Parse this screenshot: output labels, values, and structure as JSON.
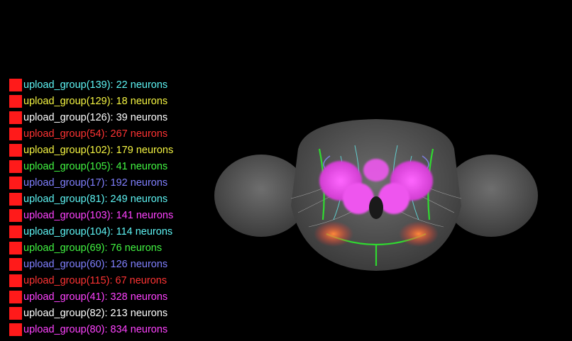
{
  "legend": {
    "swatch_color": "#ff1a1a",
    "items": [
      {
        "label": "upload_group(139): 22 neurons",
        "color": "#5ef5f5"
      },
      {
        "label": "upload_group(129): 18 neurons",
        "color": "#f5f542"
      },
      {
        "label": "upload_group(126): 39 neurons",
        "color": "#ffffff"
      },
      {
        "label": "upload_group(54): 267 neurons",
        "color": "#ff3333"
      },
      {
        "label": "upload_group(102): 179 neurons",
        "color": "#f5f542"
      },
      {
        "label": "upload_group(105): 41 neurons",
        "color": "#42f542"
      },
      {
        "label": "upload_group(17): 192 neurons",
        "color": "#8080ff"
      },
      {
        "label": "upload_group(81): 249 neurons",
        "color": "#5ef5f5"
      },
      {
        "label": "upload_group(103): 141 neurons",
        "color": "#ff42ff"
      },
      {
        "label": "upload_group(104): 114 neurons",
        "color": "#5ef5f5"
      },
      {
        "label": "upload_group(69): 76 neurons",
        "color": "#42f542"
      },
      {
        "label": "upload_group(60): 126 neurons",
        "color": "#8080ff"
      },
      {
        "label": "upload_group(115): 67 neurons",
        "color": "#ff3333"
      },
      {
        "label": "upload_group(41): 328 neurons",
        "color": "#ff42ff"
      },
      {
        "label": "upload_group(82): 213 neurons",
        "color": "#ffffff"
      },
      {
        "label": "upload_group(80): 834 neurons",
        "color": "#ff42ff"
      }
    ]
  }
}
